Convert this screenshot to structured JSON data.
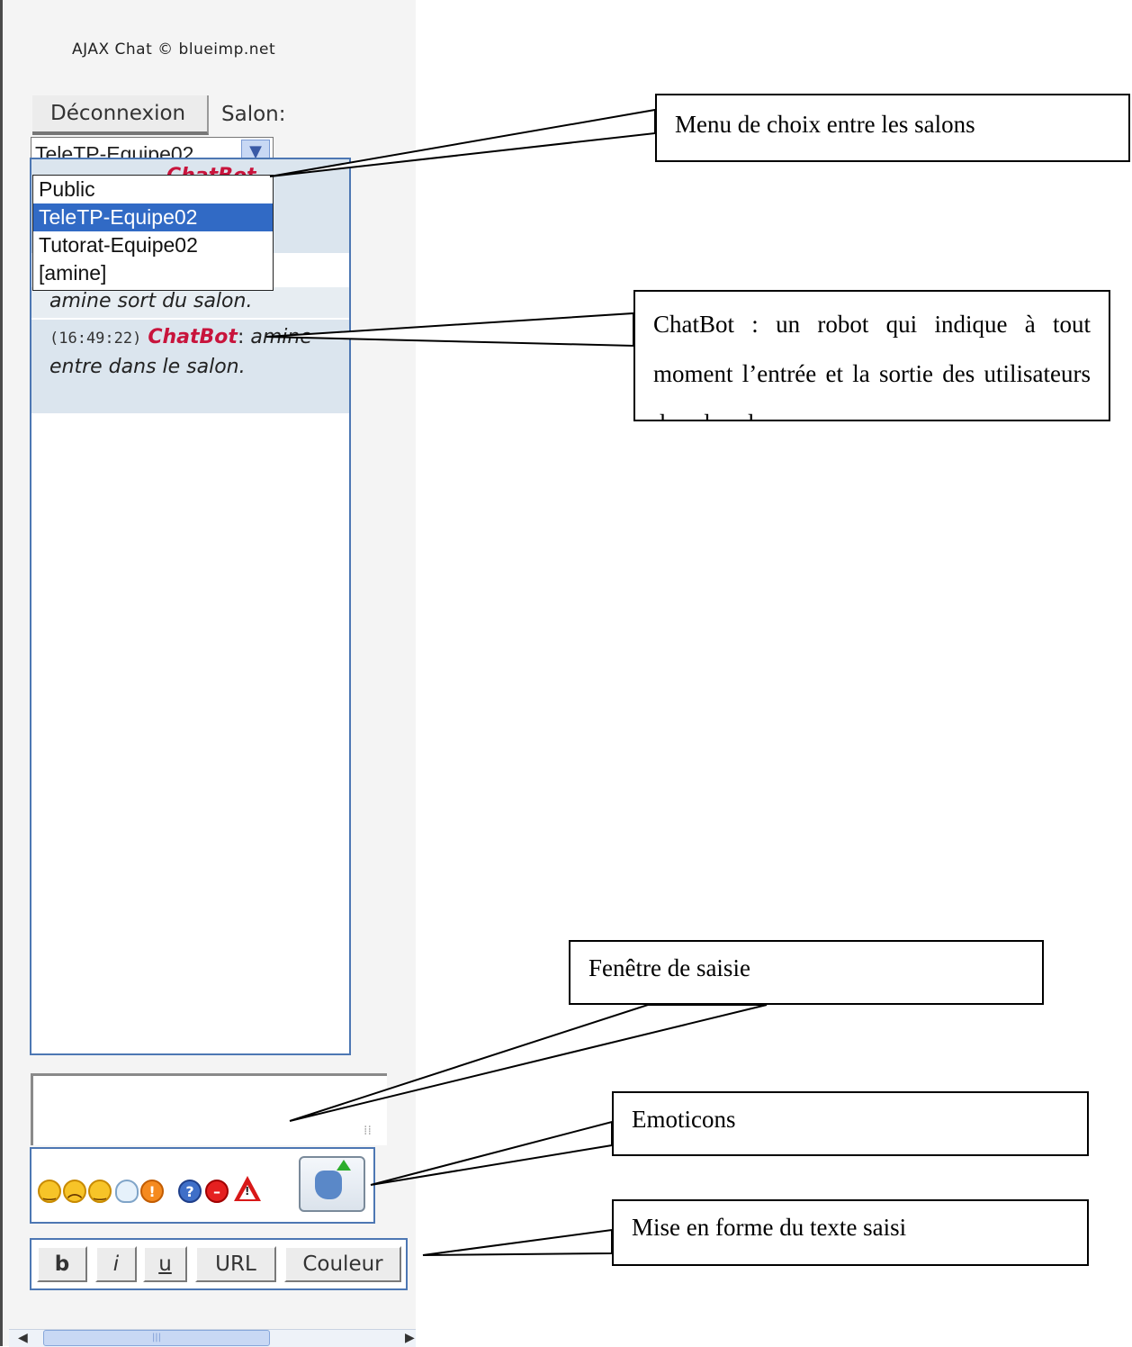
{
  "chat": {
    "credit": "AJAX Chat © blueimp.net",
    "logout_label": "Déconnexion",
    "channel_label": "Salon:",
    "selected_channel": "TeleTP-Equipe02",
    "channel_options": [
      "Public",
      "TeleTP-Equipe02",
      "Tutorat-Equipe02",
      "[amine]"
    ],
    "messages": [
      {
        "time": "",
        "user": "ChatBot",
        "text": ""
      },
      {
        "time": "",
        "user": "",
        "text": "amine sort du salon."
      },
      {
        "time": "(16:49:22)",
        "user": "ChatBot",
        "text": "amine entre dans le salon."
      }
    ],
    "emoticons": [
      "smile",
      "sad",
      "wink",
      "lightbulb",
      "exclamation",
      "question",
      "stop",
      "warning"
    ],
    "format_buttons": {
      "bold": "b",
      "italic": "i",
      "underline": "u",
      "url": "URL",
      "color": "Couleur"
    }
  },
  "callouts": {
    "salons": "Menu de choix entre les salons",
    "chatbot": "ChatBot : un robot qui indique à tout moment l’entrée et la sortie des utilisateurs dans le salon",
    "saisie": "Fenêtre de saisie",
    "emoticons": "Emoticons",
    "format": "Mise en forme du texte saisi"
  }
}
